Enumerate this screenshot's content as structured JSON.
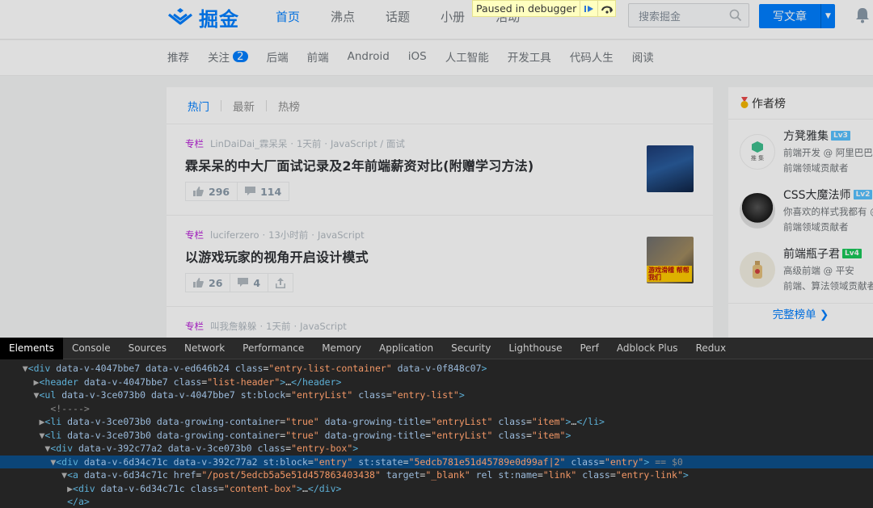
{
  "header": {
    "logo_text": "掘金",
    "nav": [
      "首页",
      "沸点",
      "话题",
      "小册",
      "活动"
    ],
    "active_nav": "首页",
    "debugger_text": "Paused in debugger",
    "search_placeholder": "搜索掘金",
    "write_label": "写文章"
  },
  "subnav": {
    "items": [
      "推荐",
      "关注",
      "后端",
      "前端",
      "Android",
      "iOS",
      "人工智能",
      "开发工具",
      "代码人生",
      "阅读"
    ],
    "follow_badge": "2"
  },
  "feed": {
    "tabs": [
      "热门",
      "最新",
      "热榜"
    ],
    "entries": [
      {
        "column": "专栏",
        "author": "LinDaiDai_霖呆呆",
        "time": "1天前",
        "tags": "JavaScript / 面试",
        "title": "霖呆呆的中大厂面试记录及2年前端薪资对比(附赠学习方法)",
        "likes": "296",
        "comments": "114"
      },
      {
        "column": "专栏",
        "author": "luciferzero",
        "time": "13小时前",
        "tags": "JavaScript",
        "title": "以游戏玩家的视角开启设计模式",
        "likes": "26",
        "comments": "4",
        "thumb_tag": "游戏滑稽 帮帮我们"
      },
      {
        "column": "专栏",
        "author": "叫我詹躲躲",
        "time": "1天前",
        "tags": "JavaScript"
      }
    ]
  },
  "sidebar": {
    "title": "作者榜",
    "authors": [
      {
        "name": "方凳雅集",
        "level": "Lv3",
        "line1": "前端开发 @ 阿里巴巴",
        "line2": "前端领域贡献者",
        "avatar_text": "推 集"
      },
      {
        "name": "CSS大魔法师",
        "level": "Lv2",
        "line1": "你喜欢的样式我都有 @",
        "line2": "前端领域贡献者"
      },
      {
        "name": "前端瓶子君",
        "level": "Lv4",
        "line1": "高级前端 @ 平安",
        "line2": "前端、算法领域贡献者"
      }
    ],
    "more": "完整榜单"
  },
  "colors": {
    "brand": "#007fff",
    "lv3": "#58c2ff",
    "lv2": "#58c2ff",
    "lv4": "#1ac85a"
  },
  "devtools": {
    "tabs": [
      "Elements",
      "Console",
      "Sources",
      "Network",
      "Performance",
      "Memory",
      "Application",
      "Security",
      "Lighthouse",
      "Perf",
      "Adblock Plus",
      "Redux"
    ],
    "dom_lines": [
      "<div data-v-4047bbe7 data-v-ed646b24 class=\"entry-list-container\" data-v-0f848c07>",
      "<header data-v-4047bbe7 class=\"list-header\">…</header>",
      "<ul data-v-3ce073b0 data-v-4047bbe7 st:block=\"entryList\" class=\"entry-list\">",
      "<!---->",
      "<li data-v-3ce073b0 data-growing-container=\"true\" data-growing-title=\"entryList\" class=\"item\">…</li>",
      "<li data-v-3ce073b0 data-growing-container=\"true\" data-growing-title=\"entryList\" class=\"item\">",
      "<div data-v-392c77a2 data-v-3ce073b0 class=\"entry-box\">",
      "<div data-v-6d34c71c data-v-392c77a2 st:block=\"entry\" st:state=\"5edcb781e51d45789e0d99af|2\" class=\"entry\"> == $0",
      "<a data-v-6d34c71c href=\"/post/5edcb5a5e51d457863403438\" target=\"_blank\" rel st:name=\"link\" class=\"entry-link\">",
      "<div data-v-6d34c71c class=\"content-box\">…</div>",
      "</a>"
    ]
  }
}
